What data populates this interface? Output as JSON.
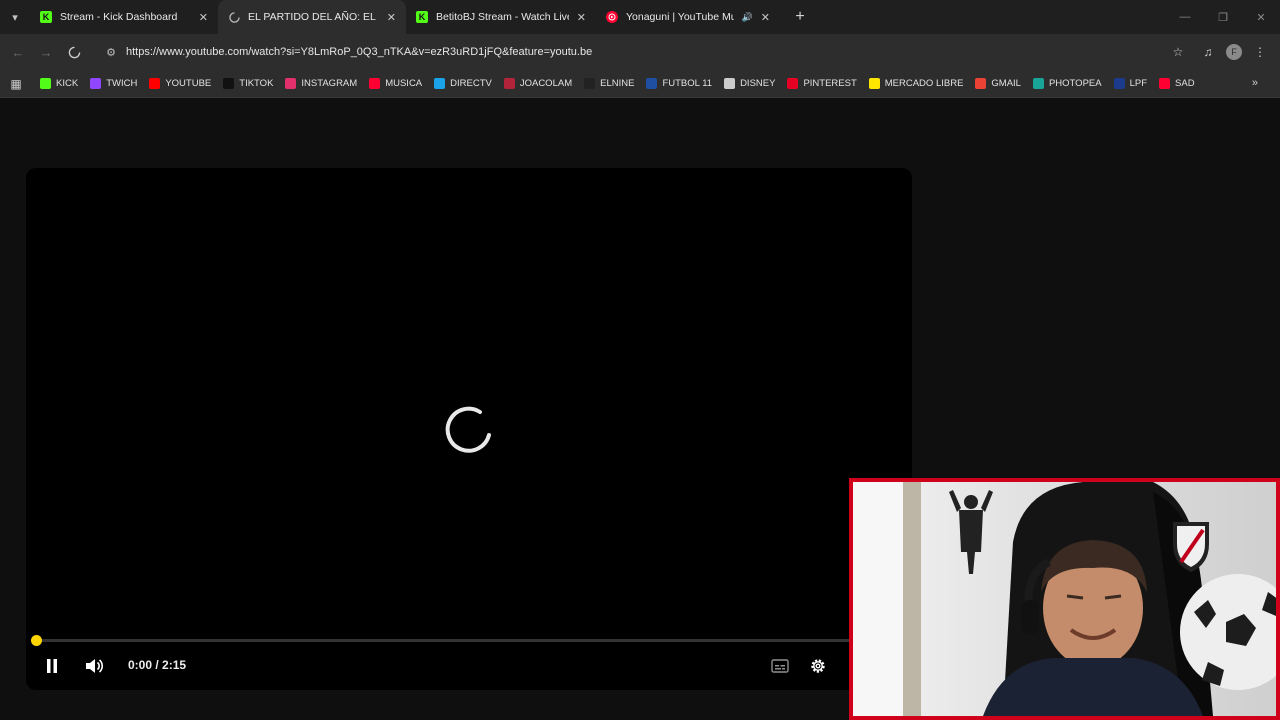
{
  "browser": {
    "tabs": [
      {
        "title": "Stream - Kick Dashboard",
        "favicon": "kick-icon",
        "active": false
      },
      {
        "title": "EL PARTIDO DEL AÑO: EL UNIT",
        "favicon": "loading-spinner-icon",
        "active": true
      },
      {
        "title": "BetitoBJ Stream - Watch Live o",
        "favicon": "kick-icon",
        "active": false
      },
      {
        "title": "Yonaguni | YouTube Music",
        "favicon": "youtube-music-icon",
        "active": false,
        "audible": true
      }
    ],
    "url": "https://www.youtube.com/watch?si=Y8LmRoP_0Q3_nTKA&v=ezR3uRD1jFQ&feature=youtu.be",
    "profile_initial": "F",
    "bookmarks": [
      {
        "label": "KICK",
        "icon": "kick-icon",
        "color": "#53fc18"
      },
      {
        "label": "TWICH",
        "icon": "twitch-icon",
        "color": "#9146ff"
      },
      {
        "label": "YOUTUBE",
        "icon": "youtube-icon",
        "color": "#ff0000"
      },
      {
        "label": "TIKTOK",
        "icon": "tiktok-icon",
        "color": "#111111"
      },
      {
        "label": "INSTAGRAM",
        "icon": "instagram-icon",
        "color": "#e1306c"
      },
      {
        "label": "MUSICA",
        "icon": "youtube-music-icon",
        "color": "#ff0033"
      },
      {
        "label": "DIRECTV",
        "icon": "directv-icon",
        "color": "#1aa3e8"
      },
      {
        "label": "JOACOLAM",
        "icon": "joacolam-icon",
        "color": "#b3243b"
      },
      {
        "label": "ELNINE",
        "icon": "elnine-icon",
        "color": "#222222"
      },
      {
        "label": "FUTBOL 11",
        "icon": "futbol11-icon",
        "color": "#1e4fa0"
      },
      {
        "label": "DISNEY",
        "icon": "disney-icon",
        "color": "#cccccc"
      },
      {
        "label": "PINTEREST",
        "icon": "pinterest-icon",
        "color": "#e60023"
      },
      {
        "label": "MERCADO LIBRE",
        "icon": "mercadolibre-icon",
        "color": "#ffe600"
      },
      {
        "label": "GMAIL",
        "icon": "gmail-icon",
        "color": "#ea4335"
      },
      {
        "label": "PHOTOPEA",
        "icon": "photopea-icon",
        "color": "#18a497"
      },
      {
        "label": "LPF",
        "icon": "lpf-icon",
        "color": "#1d3b8c"
      },
      {
        "label": "SAD",
        "icon": "sad-icon",
        "color": "#ff0033"
      }
    ]
  },
  "player": {
    "state": "buffering",
    "time_current": "0:00",
    "time_total": "2:15",
    "time_display": "0:00 / 2:15",
    "progress_fraction": 0.0,
    "accent_color": "#ffd500"
  }
}
